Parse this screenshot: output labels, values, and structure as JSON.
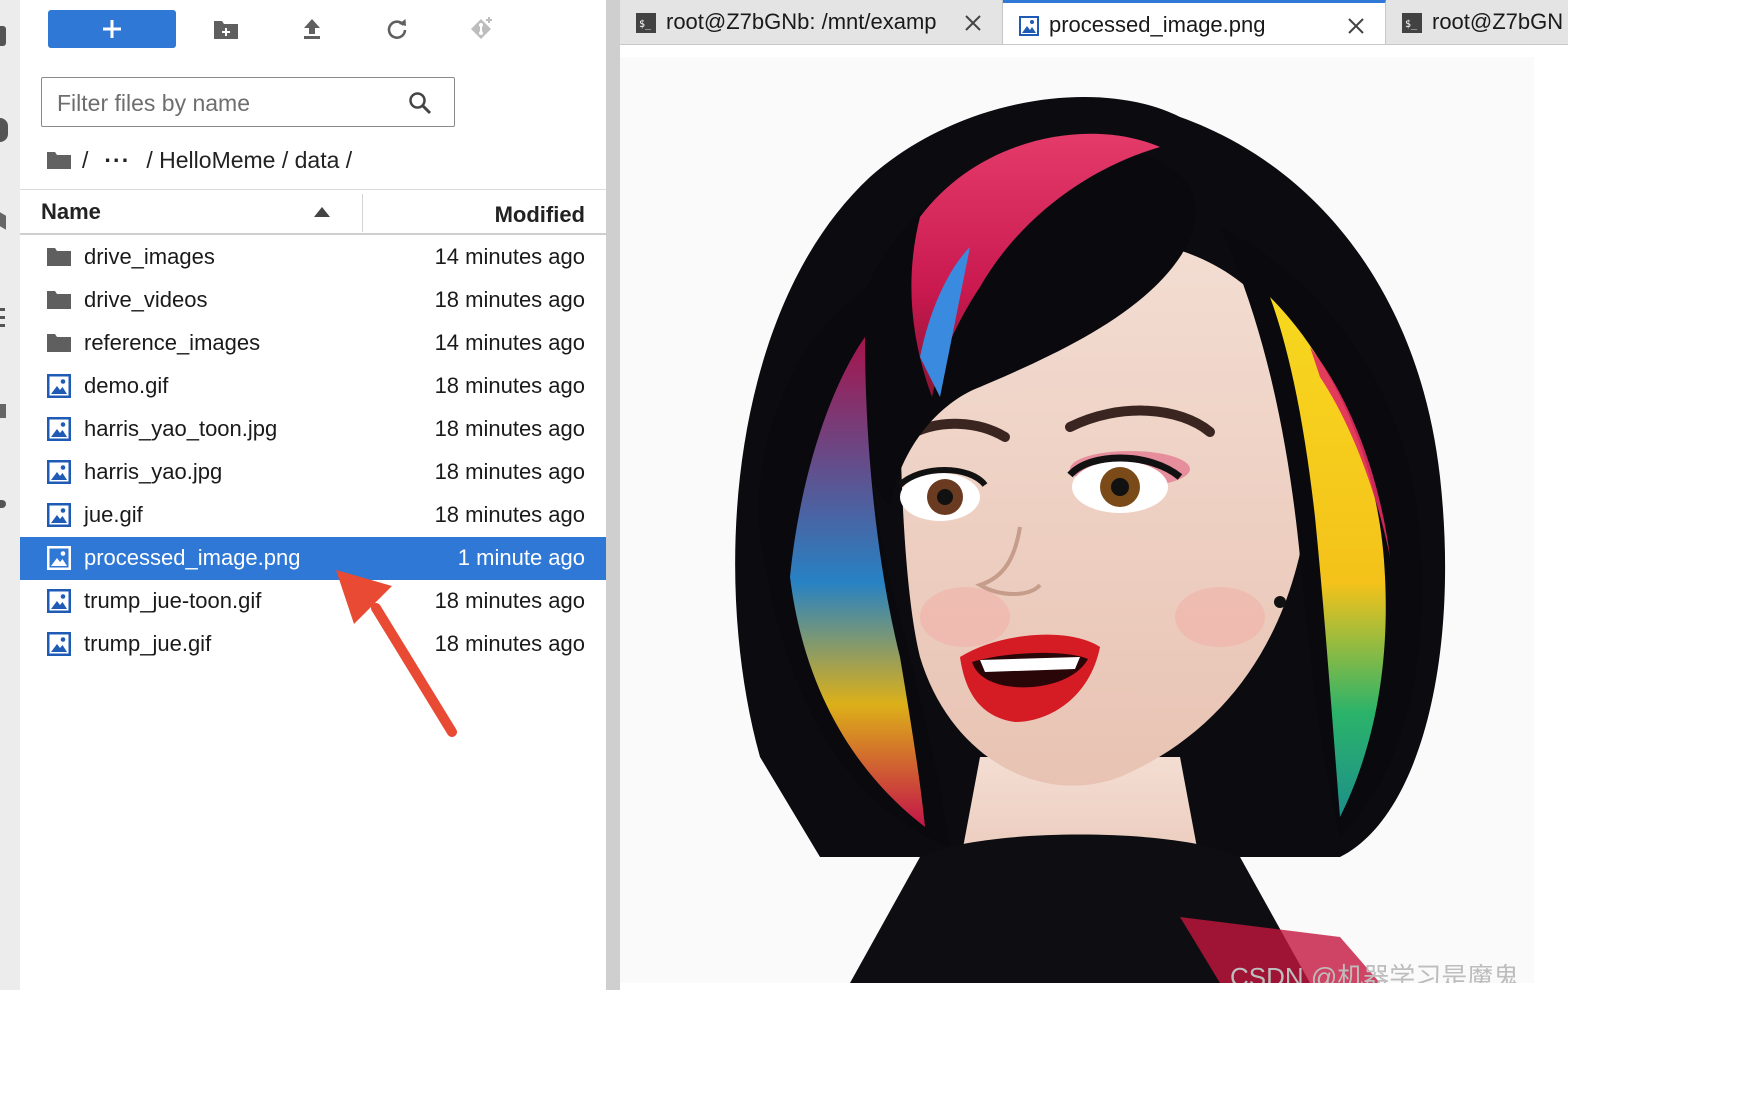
{
  "toolbar": {
    "new_launcher": "New Launcher",
    "new_folder": "New Folder",
    "upload": "Upload Files",
    "refresh": "Refresh File List",
    "git_clone": "Git Clone"
  },
  "filter": {
    "placeholder": "Filter files by name",
    "value": ""
  },
  "breadcrumb": {
    "root": "/",
    "ellipsis": "···",
    "path": "/ HelloMeme / data /"
  },
  "file_list": {
    "columns": {
      "name": "Name",
      "modified": "Modified"
    },
    "sort": "name-ascending",
    "rows": [
      {
        "name": "drive_images",
        "modified": "14 minutes ago",
        "type": "folder"
      },
      {
        "name": "drive_videos",
        "modified": "18 minutes ago",
        "type": "folder"
      },
      {
        "name": "reference_images",
        "modified": "14 minutes ago",
        "type": "folder"
      },
      {
        "name": "demo.gif",
        "modified": "18 minutes ago",
        "type": "image"
      },
      {
        "name": "harris_yao_toon.jpg",
        "modified": "18 minutes ago",
        "type": "image"
      },
      {
        "name": "harris_yao.jpg",
        "modified": "18 minutes ago",
        "type": "image"
      },
      {
        "name": "jue.gif",
        "modified": "18 minutes ago",
        "type": "image"
      },
      {
        "name": "processed_image.png",
        "modified": "1 minute ago",
        "type": "image",
        "selected": true
      },
      {
        "name": "trump_jue-toon.gif",
        "modified": "18 minutes ago",
        "type": "image"
      },
      {
        "name": "trump_jue.gif",
        "modified": "18 minutes ago",
        "type": "image"
      }
    ]
  },
  "tabs": [
    {
      "label": "root@Z7bGNb: /mnt/examp",
      "icon": "terminal-icon",
      "active": false
    },
    {
      "label": "processed_image.png",
      "icon": "image-icon",
      "active": true
    },
    {
      "label": "root@Z7bGN",
      "icon": "terminal-icon",
      "active": false
    }
  ],
  "viewer": {
    "image_subject": "stylized illustration of a woman with black bob hair streaked with pink, yellow, green and blue",
    "watermark": "CSDN @机器学习是魔鬼"
  },
  "colors": {
    "accent": "#2f78d6",
    "annotation_arrow": "#e84a33",
    "selected_row_text": "#ffffff"
  }
}
